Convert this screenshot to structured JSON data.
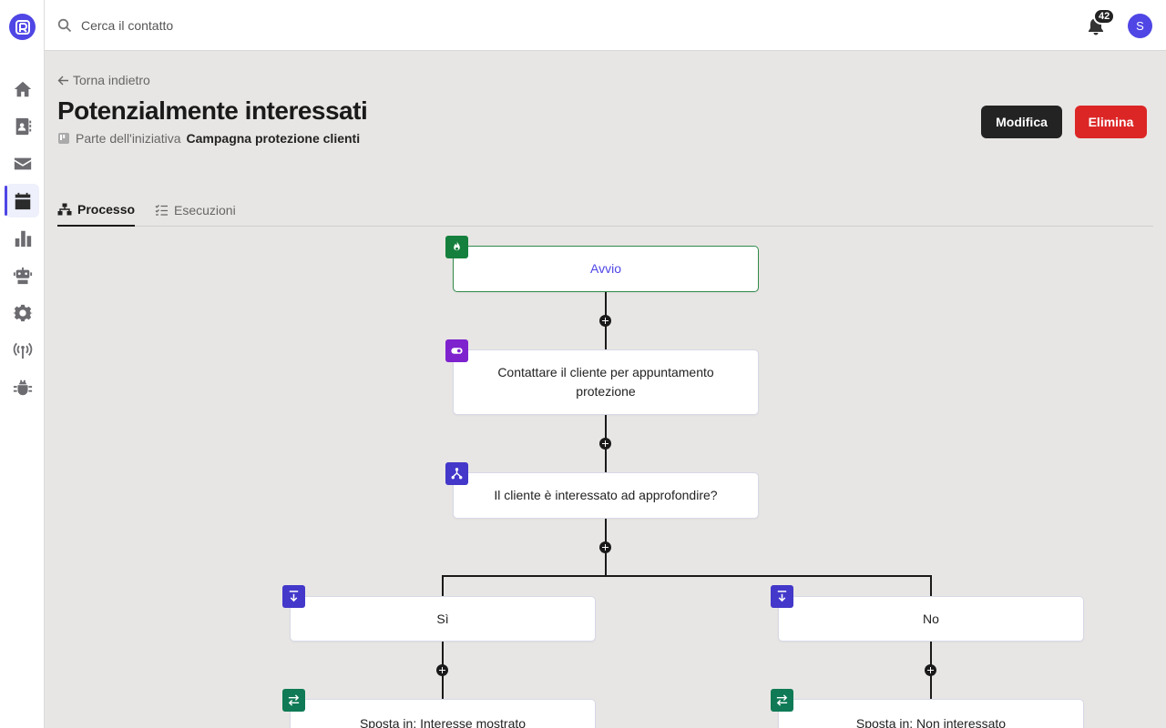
{
  "search": {
    "placeholder": "Cerca il contatto"
  },
  "notifications": {
    "count": "42"
  },
  "user": {
    "initial": "S"
  },
  "nav": {
    "items": [
      {
        "icon": "home-icon"
      },
      {
        "icon": "contacts-icon"
      },
      {
        "icon": "mail-icon"
      },
      {
        "icon": "calendar-icon",
        "active": true
      },
      {
        "icon": "bar-chart-icon"
      },
      {
        "icon": "robot-icon"
      },
      {
        "icon": "gear-icon"
      },
      {
        "icon": "antenna-icon"
      },
      {
        "icon": "bug-icon"
      }
    ]
  },
  "header": {
    "back_label": "Torna indietro",
    "title": "Potenzialmente interessati",
    "subtitle_prefix": "Parte dell'iniziativa",
    "subtitle_link": "Campagna protezione clienti",
    "edit_label": "Modifica",
    "delete_label": "Elimina"
  },
  "tabs": [
    {
      "label": "Processo",
      "icon": "sitemap-icon",
      "active": true
    },
    {
      "label": "Esecuzioni",
      "icon": "checklist-icon",
      "active": false
    }
  ],
  "flow": {
    "start": {
      "label": "Avvio",
      "icon": "fire-icon"
    },
    "action": {
      "label": "Contattare il cliente per appuntamento protezione",
      "icon": "toggle-icon"
    },
    "condition": {
      "label": "Il cliente è interessato ad approfondire?",
      "icon": "branch-icon"
    },
    "branch_yes": {
      "label": "Sì",
      "icon": "arrow-down-to-line-icon"
    },
    "branch_no": {
      "label": "No",
      "icon": "arrow-down-to-line-icon"
    },
    "move_yes": {
      "label": "Sposta in: Interesse mostrato",
      "icon": "swap-icon"
    },
    "move_no": {
      "label": "Sposta in: Non interessato",
      "icon": "swap-icon"
    }
  },
  "colors": {
    "accent": "#4f46e5",
    "danger": "#dc2626",
    "start_icon": "#15803d",
    "action_icon": "#7e22ce",
    "condition_icon": "#4338ca",
    "move_icon": "#0f7a55"
  }
}
